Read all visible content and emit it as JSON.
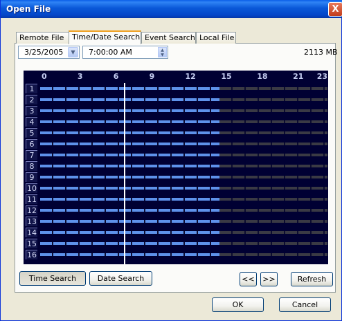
{
  "window": {
    "title": "Open File",
    "close_glyph": "X"
  },
  "tabs": [
    {
      "label": "Remote File",
      "active": false
    },
    {
      "label": "Time/Date Search",
      "active": true
    },
    {
      "label": "Event Search",
      "active": false
    },
    {
      "label": "Local File",
      "active": false
    }
  ],
  "search": {
    "date": "3/25/2005",
    "time": "7:00:00 AM",
    "disk_space": "2113 MB"
  },
  "timeline": {
    "hour_labels": [
      "0",
      "3",
      "6",
      "9",
      "12",
      "15",
      "18",
      "21",
      "23"
    ],
    "channels": [
      "1",
      "2",
      "3",
      "4",
      "5",
      "6",
      "7",
      "8",
      "9",
      "10",
      "11",
      "12",
      "13",
      "14",
      "15",
      "16"
    ],
    "recorded_until_hour": 15,
    "cursor_hour": 7,
    "colors": {
      "background": "#000033",
      "recorded": "#5e92ea",
      "empty": "#3a3a44",
      "cursor": "#ffffff"
    }
  },
  "buttons": {
    "time_search": "Time Search",
    "date_search": "Date Search",
    "prev": "<<",
    "next": ">>",
    "refresh": "Refresh",
    "ok": "OK",
    "cancel": "Cancel"
  },
  "icons": {
    "dropdown": "chevron-down-icon",
    "spinner": "spin-updown-icon",
    "close": "close-icon"
  }
}
